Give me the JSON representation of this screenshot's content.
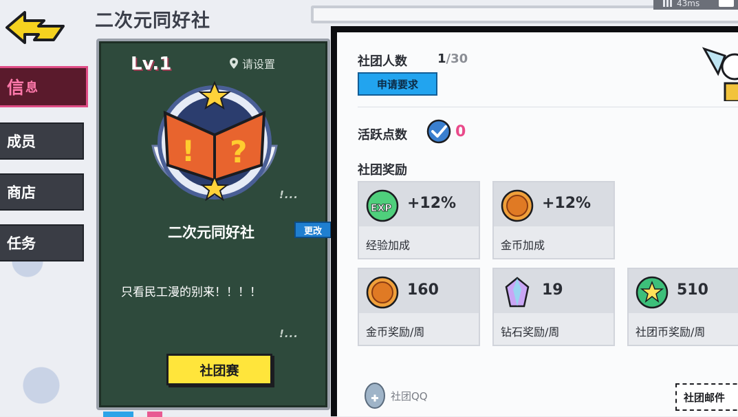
{
  "header": {
    "title": "二次元同好社",
    "ping": "43ms"
  },
  "sidebar": {
    "items": [
      {
        "label": "信",
        "suffix": "息",
        "active": true
      },
      {
        "label": "成员"
      },
      {
        "label": "商店"
      },
      {
        "label": "任务"
      }
    ]
  },
  "board": {
    "level": "Lv.1",
    "location": "请设置",
    "club_name": "二次元同好社",
    "edit_label": "更改",
    "motto": "只看民工漫的别来！！！！",
    "race_button": "社团赛"
  },
  "info": {
    "member_label": "社团人数",
    "member_current": "1",
    "member_max": "/30",
    "apply_button": "申请要求",
    "active_label": "活跃点数",
    "active_value": "0",
    "reward_label": "社团奖励",
    "rewards": [
      {
        "icon": "exp-icon",
        "value": "+12%",
        "name": "经验加成"
      },
      {
        "icon": "gold-coin-icon",
        "value": "+12%",
        "name": "金币加成"
      },
      {
        "icon": "gold-coin-icon",
        "value": "160",
        "name": "金币奖励/周"
      },
      {
        "icon": "diamond-icon",
        "value": "19",
        "name": "钻石奖励/周"
      },
      {
        "icon": "club-coin-icon",
        "value": "510",
        "name": "社团币奖励/周"
      }
    ],
    "qq_label": "社团QQ",
    "mail_button": "社团邮件"
  },
  "colors": {
    "accent_pink": "#e94a8a",
    "button_blue": "#22a4ef",
    "board_green": "#2e4a3c",
    "race_yellow": "#ffe53b"
  }
}
